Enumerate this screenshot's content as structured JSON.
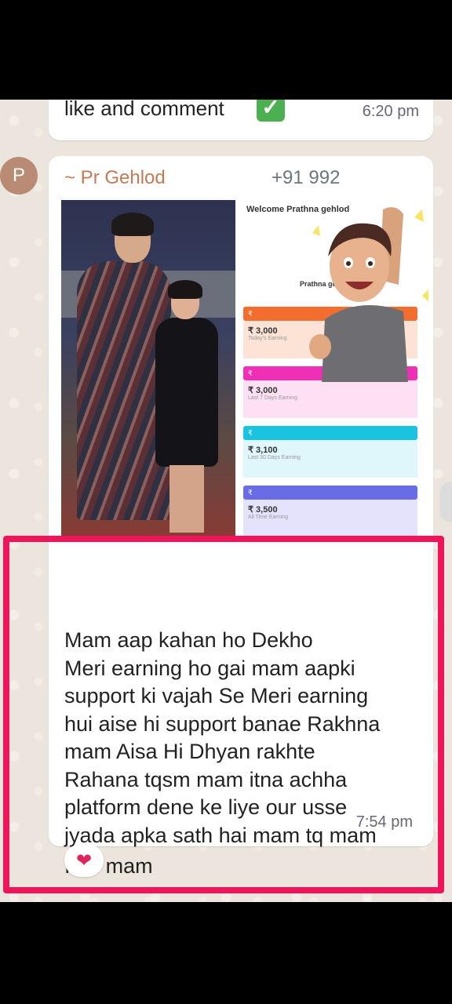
{
  "previous_message": {
    "text": "like and comment",
    "emoji": "✓",
    "time": "6:20 pm"
  },
  "sender": {
    "avatar_letter": "P",
    "name": "~ Pr Gehlod",
    "phone": "+91 992"
  },
  "screenshot": {
    "welcome": "Welcome Prathna gehlod",
    "profile_name": "Prathna gehlod",
    "cards": [
      {
        "currency": "₹",
        "amount": "₹ 3,000",
        "label": "Today's Earning",
        "color": "#f26d2e"
      },
      {
        "currency": "₹",
        "amount": "₹ 3,000",
        "label": "Last 7 Days Earning",
        "color": "#ef2fb5"
      },
      {
        "currency": "₹",
        "amount": "₹ 3,100",
        "label": "Last 30 Days Earning",
        "color": "#1ac3e0"
      },
      {
        "currency": "₹",
        "amount": "₹ 3,500",
        "label": "All Time Earning",
        "color": "#6a6ce6"
      }
    ]
  },
  "message": {
    "lines": [
      "Mam aap kahan ho Dekho",
      "Meri earning ho gai mam aapki",
      "support ki vajah Se Meri earning",
      "hui aise hi support banae Rakhna",
      "mam Aisa Hi Dhyan rakhte",
      "Rahana tqsm mam itna achha",
      "platform dene ke liye our usse",
      "jyada apka sath hai mam tq mam"
    ],
    "last_line_prefix": "I",
    "last_line_heart": "❤",
    "last_line_suffix": "u mam",
    "time": "7:54 pm",
    "reaction": "❤"
  },
  "colors": {
    "highlight": "#f0145a",
    "sender_name": "#c47a55",
    "chat_bg": "#ece5dd"
  }
}
